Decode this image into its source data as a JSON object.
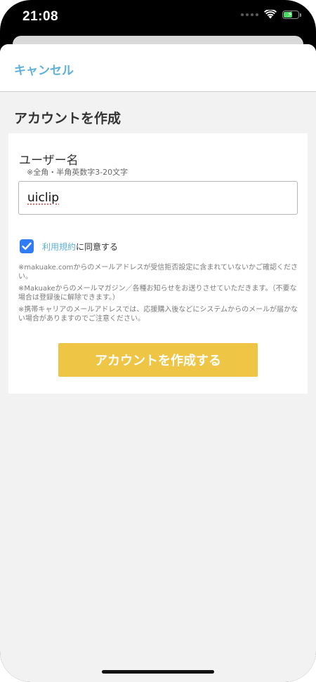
{
  "status_bar": {
    "time": "21:08",
    "battery_level": 0.6
  },
  "navbar": {
    "cancel_label": "キャンセル"
  },
  "page": {
    "title": "アカウントを作成"
  },
  "form": {
    "username_label": "ユーザー名",
    "username_hint": "※全角・半角英数字3-20文字",
    "username_value": "uiclip",
    "agree_checked": true,
    "terms_link": "利用規約",
    "agree_suffix": "に同意する",
    "notices": [
      "※makuake.comからのメールアドレスが受信拒否設定に含まれていないかご確認ください。",
      "※Makuakeからのメールマガジン／各種お知らせをお送りさせていただきます。（不要な場合は登録後に解除できます。）",
      "※携帯キャリアのメールアドレスでは、応援購入後などにシステムからのメールが届かない場合がありますのでご注意ください。"
    ],
    "submit_label": "アカウントを作成する"
  },
  "colors": {
    "accent_link": "#5fb0d6",
    "submit_button": "#eec545",
    "checkbox": "#2f7cf6"
  }
}
